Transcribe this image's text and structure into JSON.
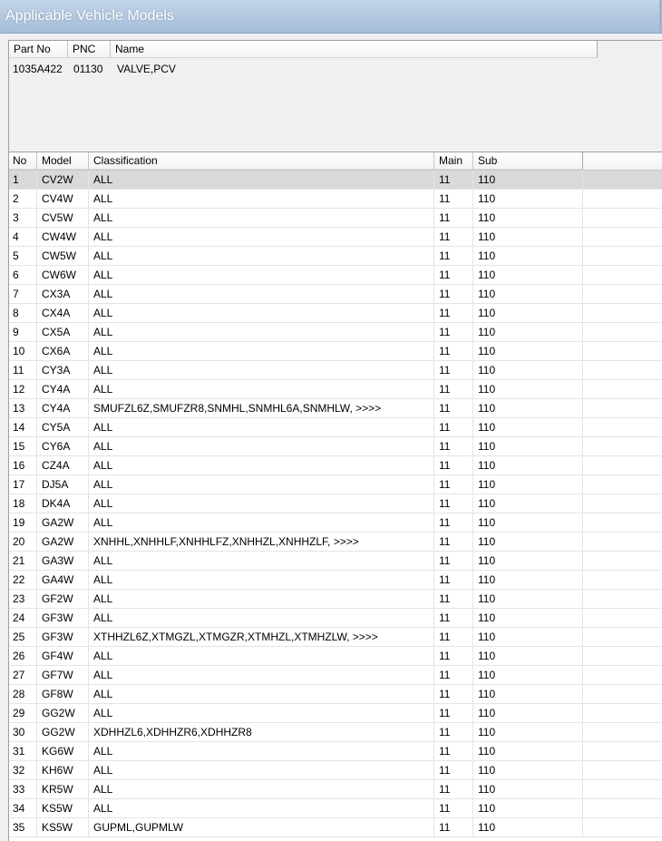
{
  "window": {
    "title": "Applicable Vehicle Models"
  },
  "part_table": {
    "columns": [
      "Part No",
      "PNC",
      "Name"
    ],
    "row": {
      "part_no": "1035A422",
      "pnc": "01130",
      "name": "VALVE,PCV"
    }
  },
  "models_table": {
    "columns": [
      "No",
      "Model",
      "Classification",
      "Main",
      "Sub"
    ],
    "selected_row": 1,
    "rows": [
      {
        "no": "1",
        "model": "CV2W",
        "classification": "ALL",
        "main": "11",
        "sub": "110"
      },
      {
        "no": "2",
        "model": "CV4W",
        "classification": "ALL",
        "main": "11",
        "sub": "110"
      },
      {
        "no": "3",
        "model": "CV5W",
        "classification": "ALL",
        "main": "11",
        "sub": "110"
      },
      {
        "no": "4",
        "model": "CW4W",
        "classification": "ALL",
        "main": "11",
        "sub": "110"
      },
      {
        "no": "5",
        "model": "CW5W",
        "classification": "ALL",
        "main": "11",
        "sub": "110"
      },
      {
        "no": "6",
        "model": "CW6W",
        "classification": "ALL",
        "main": "11",
        "sub": "110"
      },
      {
        "no": "7",
        "model": "CX3A",
        "classification": "ALL",
        "main": "11",
        "sub": "110"
      },
      {
        "no": "8",
        "model": "CX4A",
        "classification": "ALL",
        "main": "11",
        "sub": "110"
      },
      {
        "no": "9",
        "model": "CX5A",
        "classification": "ALL",
        "main": "11",
        "sub": "110"
      },
      {
        "no": "10",
        "model": "CX6A",
        "classification": "ALL",
        "main": "11",
        "sub": "110"
      },
      {
        "no": "11",
        "model": "CY3A",
        "classification": "ALL",
        "main": "11",
        "sub": "110"
      },
      {
        "no": "12",
        "model": "CY4A",
        "classification": "ALL",
        "main": "11",
        "sub": "110"
      },
      {
        "no": "13",
        "model": "CY4A",
        "classification": "SMUFZL6Z,SMUFZR8,SNMHL,SNMHL6A,SNMHLW,  >>>>",
        "main": "11",
        "sub": "110"
      },
      {
        "no": "14",
        "model": "CY5A",
        "classification": "ALL",
        "main": "11",
        "sub": "110"
      },
      {
        "no": "15",
        "model": "CY6A",
        "classification": "ALL",
        "main": "11",
        "sub": "110"
      },
      {
        "no": "16",
        "model": "CZ4A",
        "classification": "ALL",
        "main": "11",
        "sub": "110"
      },
      {
        "no": "17",
        "model": "DJ5A",
        "classification": "ALL",
        "main": "11",
        "sub": "110"
      },
      {
        "no": "18",
        "model": "DK4A",
        "classification": "ALL",
        "main": "11",
        "sub": "110"
      },
      {
        "no": "19",
        "model": "GA2W",
        "classification": "ALL",
        "main": "11",
        "sub": "110"
      },
      {
        "no": "20",
        "model": "GA2W",
        "classification": "XNHHL,XNHHLF,XNHHLFZ,XNHHZL,XNHHZLF,  >>>>",
        "main": "11",
        "sub": "110"
      },
      {
        "no": "21",
        "model": "GA3W",
        "classification": "ALL",
        "main": "11",
        "sub": "110"
      },
      {
        "no": "22",
        "model": "GA4W",
        "classification": "ALL",
        "main": "11",
        "sub": "110"
      },
      {
        "no": "23",
        "model": "GF2W",
        "classification": "ALL",
        "main": "11",
        "sub": "110"
      },
      {
        "no": "24",
        "model": "GF3W",
        "classification": "ALL",
        "main": "11",
        "sub": "110"
      },
      {
        "no": "25",
        "model": "GF3W",
        "classification": "XTHHZL6Z,XTMGZL,XTMGZR,XTMHZL,XTMHZLW,  >>>>",
        "main": "11",
        "sub": "110"
      },
      {
        "no": "26",
        "model": "GF4W",
        "classification": "ALL",
        "main": "11",
        "sub": "110"
      },
      {
        "no": "27",
        "model": "GF7W",
        "classification": "ALL",
        "main": "11",
        "sub": "110"
      },
      {
        "no": "28",
        "model": "GF8W",
        "classification": "ALL",
        "main": "11",
        "sub": "110"
      },
      {
        "no": "29",
        "model": "GG2W",
        "classification": "ALL",
        "main": "11",
        "sub": "110"
      },
      {
        "no": "30",
        "model": "GG2W",
        "classification": "XDHHZL6,XDHHZR6,XDHHZR8",
        "main": "11",
        "sub": "110"
      },
      {
        "no": "31",
        "model": "KG6W",
        "classification": "ALL",
        "main": "11",
        "sub": "110"
      },
      {
        "no": "32",
        "model": "KH6W",
        "classification": "ALL",
        "main": "11",
        "sub": "110"
      },
      {
        "no": "33",
        "model": "KR5W",
        "classification": "ALL",
        "main": "11",
        "sub": "110"
      },
      {
        "no": "34",
        "model": "KS5W",
        "classification": "ALL",
        "main": "11",
        "sub": "110"
      },
      {
        "no": "35",
        "model": "KS5W",
        "classification": "GUPML,GUPMLW",
        "main": "11",
        "sub": "110"
      }
    ]
  }
}
